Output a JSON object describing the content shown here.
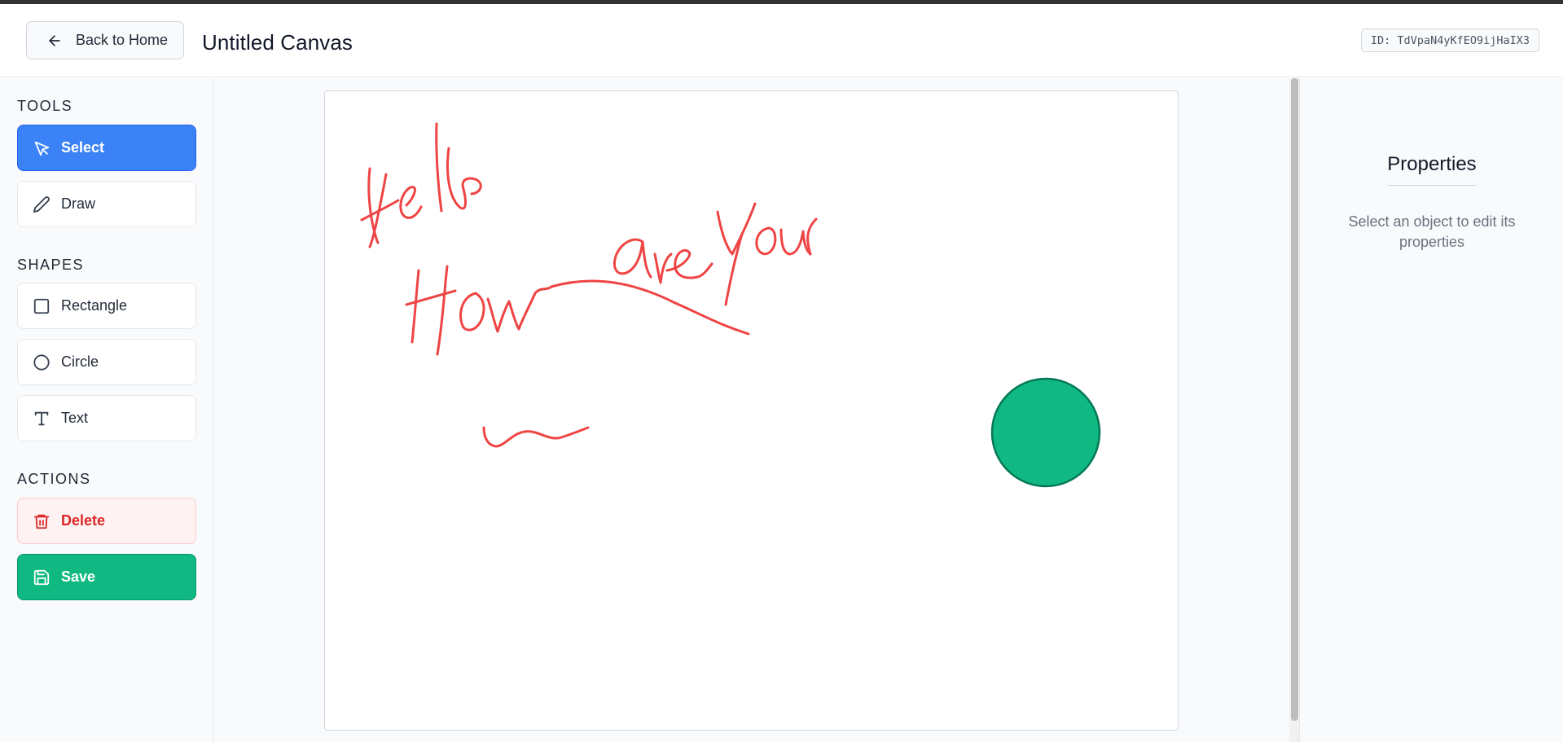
{
  "header": {
    "back_label": "Back to Home",
    "title": "Untitled Canvas",
    "canvas_id": "ID: TdVpaN4yKfEO9ijHaIX3"
  },
  "sidebar": {
    "tools_title": "TOOLS",
    "tools": [
      {
        "label": "Select",
        "icon": "cursor-icon",
        "active": true
      },
      {
        "label": "Draw",
        "icon": "pencil-icon",
        "active": false
      }
    ],
    "shapes_title": "SHAPES",
    "shapes": [
      {
        "label": "Rectangle",
        "icon": "square-icon"
      },
      {
        "label": "Circle",
        "icon": "circle-icon"
      },
      {
        "label": "Text",
        "icon": "text-icon"
      }
    ],
    "actions_title": "ACTIONS",
    "actions": [
      {
        "label": "Delete",
        "icon": "trash-icon"
      },
      {
        "label": "Save",
        "icon": "save-icon"
      }
    ]
  },
  "canvas": {
    "stroke_color": "#ef4444",
    "circle_fill": "#10b981",
    "circle_stroke": "#047857"
  },
  "properties": {
    "title": "Properties",
    "hint": "Select an object to edit its properties"
  },
  "colors": {
    "primary": "#3b82f6",
    "danger": "#dc2626",
    "success": "#10b981"
  }
}
